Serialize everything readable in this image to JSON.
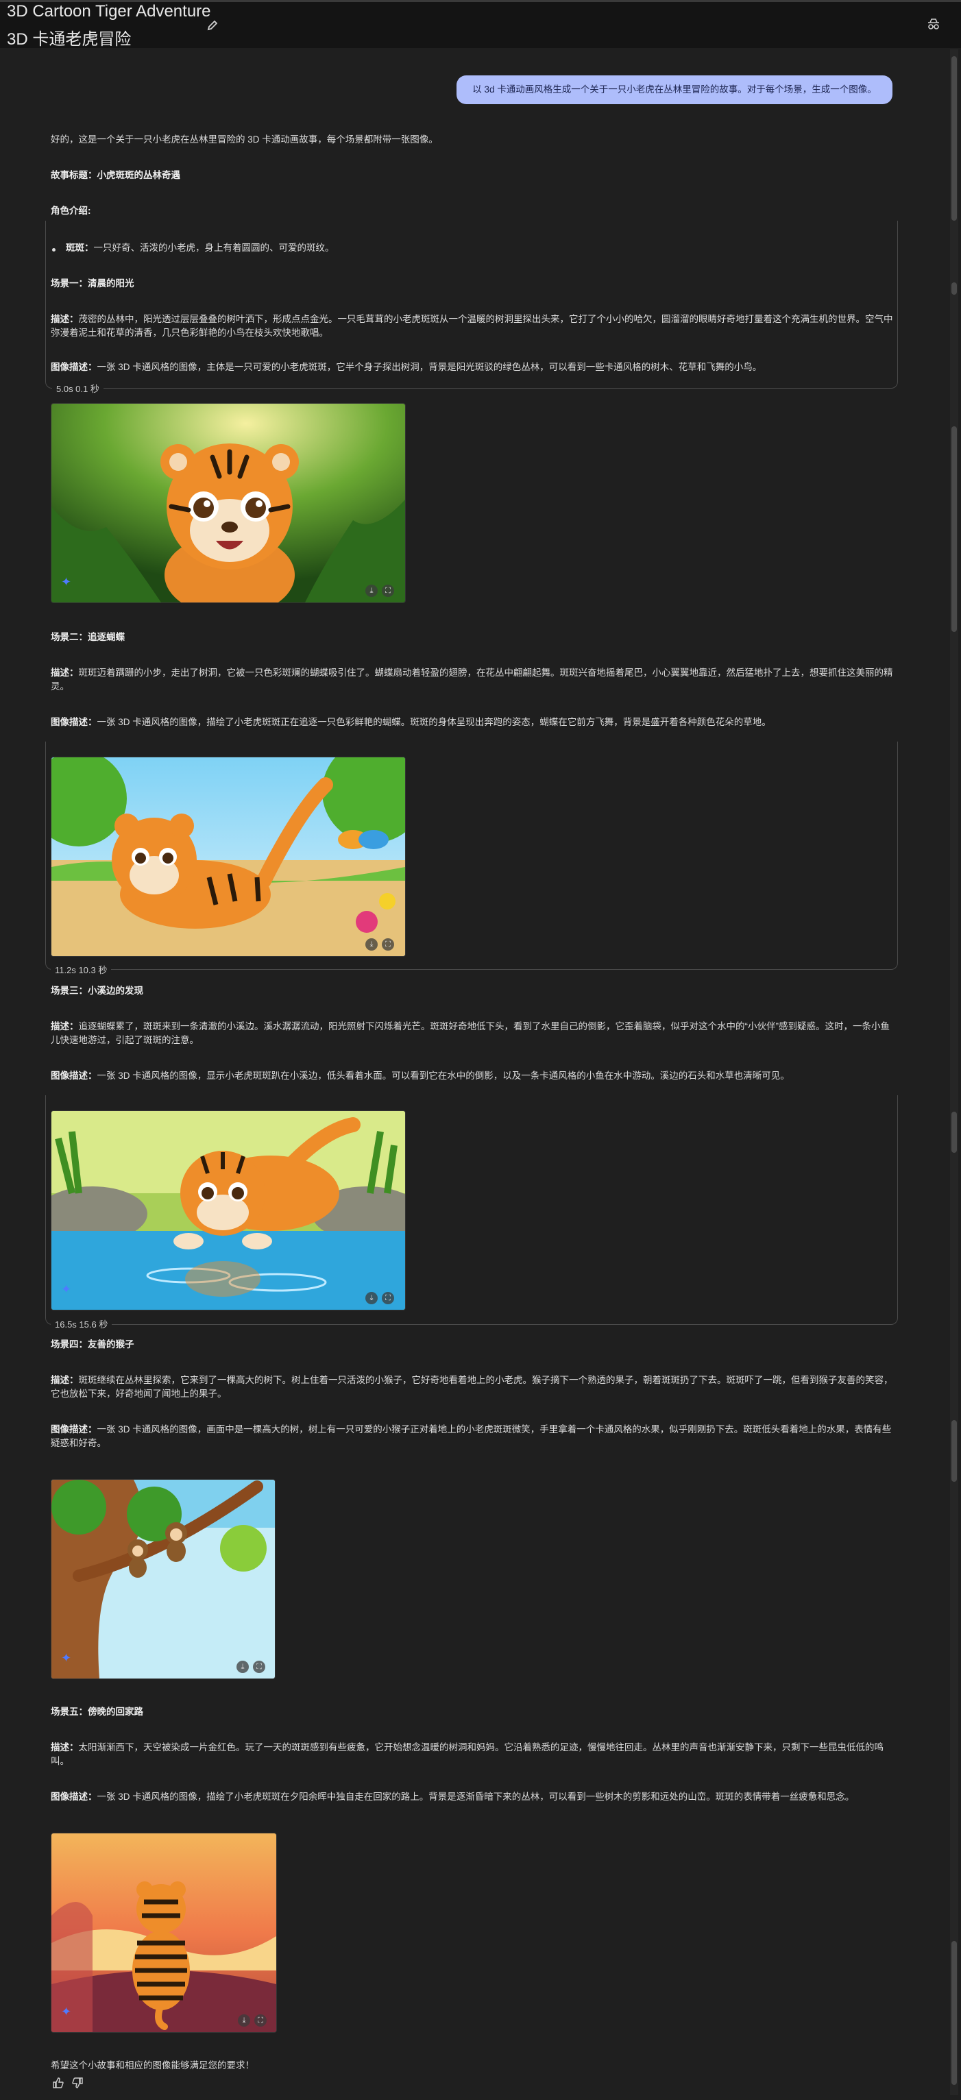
{
  "header": {
    "title_en": "3D Cartoon Tiger Adventure",
    "title_zh": "3D 卡通老虎冒险"
  },
  "user_prompt": "以 3d 卡通动画风格生成一个关于一只小老虎在丛林里冒险的故事。对于每个场景，生成一个图像。",
  "response": {
    "intro": "好的，这是一个关于一只小老虎在丛林里冒险的 3D 卡通动画故事，每个场景都附带一张图像。",
    "story_title_label": "故事标题：",
    "story_title": "小虎斑斑的丛林奇遇",
    "characters_heading": "角色介绍:",
    "character_name": "斑斑：",
    "character_desc": "一只好奇、活泼的小老虎，身上有着圆圆的、可爱的斑纹。",
    "desc_label": "描述：",
    "img_desc_label": "图像描述：",
    "scenes": [
      {
        "heading": "场景一：清晨的阳光",
        "desc": "茂密的丛林中，阳光透过层层叠叠的树叶洒下，形成点点金光。一只毛茸茸的小老虎斑斑从一个温暖的树洞里探出头来，它打了个小小的哈欠，圆溜溜的眼睛好奇地打量着这个充满生机的世界。空气中弥漫着泥土和花草的清香，几只色彩鲜艳的小鸟在枝头欢快地歌唱。",
        "image_desc": "一张 3D 卡通风格的图像，主体是一只可爱的小老虎斑斑，它半个身子探出树洞，背景是阳光斑驳的绿色丛林，可以看到一些卡通风格的树木、花草和飞舞的小鸟。",
        "timing": "5.0s  0.1 秒"
      },
      {
        "heading": "场景二：追逐蝴蝶",
        "desc": "斑斑迈着蹒跚的小步，走出了树洞，它被一只色彩斑斓的蝴蝶吸引住了。蝴蝶扇动着轻盈的翅膀，在花丛中翩翩起舞。斑斑兴奋地摇着尾巴，小心翼翼地靠近，然后猛地扑了上去，想要抓住这美丽的精灵。",
        "image_desc": "一张 3D 卡通风格的图像，描绘了小老虎斑斑正在追逐一只色彩鲜艳的蝴蝶。斑斑的身体呈现出奔跑的姿态，蝴蝶在它前方飞舞，背景是盛开着各种颜色花朵的草地。",
        "timing": "11.2s  10.3 秒"
      },
      {
        "heading": "场景三：小溪边的发现",
        "desc": "追逐蝴蝶累了，斑斑来到一条清澈的小溪边。溪水潺潺流动，阳光照射下闪烁着光芒。斑斑好奇地低下头，看到了水里自己的倒影，它歪着脑袋，似乎对这个水中的“小伙伴”感到疑惑。这时，一条小鱼儿快速地游过，引起了斑斑的注意。",
        "image_desc": "一张 3D 卡通风格的图像，显示小老虎斑斑趴在小溪边，低头看着水面。可以看到它在水中的倒影，以及一条卡通风格的小鱼在水中游动。溪边的石头和水草也清晰可见。",
        "timing": "16.5s  15.6 秒"
      },
      {
        "heading": "场景四：友善的猴子",
        "desc": "斑斑继续在丛林里探索，它来到了一棵高大的树下。树上住着一只活泼的小猴子，它好奇地看着地上的小老虎。猴子摘下一个熟透的果子，朝着斑斑扔了下去。斑斑吓了一跳，但看到猴子友善的笑容，它也放松下来，好奇地闻了闻地上的果子。",
        "image_desc": "一张 3D 卡通风格的图像，画面中是一棵高大的树，树上有一只可爱的小猴子正对着地上的小老虎斑斑微笑，手里拿着一个卡通风格的水果，似乎刚刚扔下去。斑斑低头看着地上的水果，表情有些疑惑和好奇。"
      },
      {
        "heading": "场景五：傍晚的回家路",
        "desc": "太阳渐渐西下，天空被染成一片金红色。玩了一天的斑斑感到有些疲惫，它开始想念温暖的树洞和妈妈。它沿着熟悉的足迹，慢慢地往回走。丛林里的声音也渐渐安静下来，只剩下一些昆虫低低的鸣叫。",
        "image_desc": "一张 3D 卡通风格的图像，描绘了小老虎斑斑在夕阳余晖中独自走在回家的路上。背景是逐渐昏暗下来的丛林，可以看到一些树木的剪影和远处的山峦。斑斑的表情带着一丝疲惫和思念。"
      }
    ],
    "closing": "希望这个小故事和相应的图像能够满足您的要求！"
  },
  "colors": {
    "background": "#1f1f1f",
    "user_bubble": "#aebdfb",
    "sparkle": "#4f7bff"
  },
  "icons": [
    "edit-pencil-icon",
    "incognito-icon",
    "sparkle-icon",
    "download-icon",
    "fullscreen-icon",
    "thumbs-up-icon",
    "thumbs-down-icon"
  ]
}
